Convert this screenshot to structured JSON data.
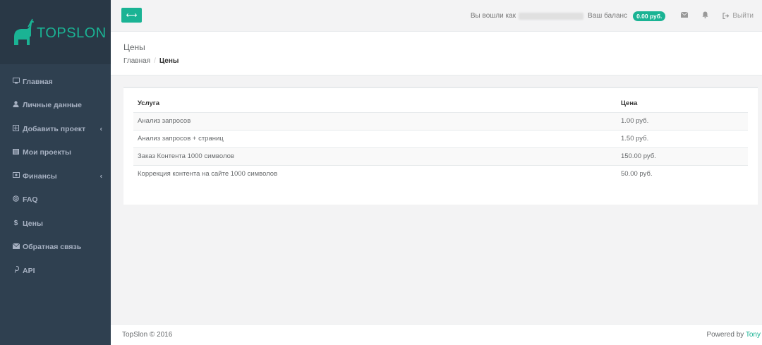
{
  "brand": {
    "name": "TOPSLON",
    "accent_color": "#1ab394"
  },
  "sidebar": {
    "items": [
      {
        "label": "Главная",
        "icon": "desktop-icon"
      },
      {
        "label": "Личные данные",
        "icon": "user-icon"
      },
      {
        "label": "Добавить проект",
        "icon": "plus-square-icon",
        "has_arrow": true
      },
      {
        "label": "Мои проекты",
        "icon": "list-icon"
      },
      {
        "label": "Финансы",
        "icon": "money-icon",
        "has_arrow": true
      },
      {
        "label": "FAQ",
        "icon": "lifebuoy-icon"
      },
      {
        "label": "Цены",
        "icon": "dollar-icon"
      },
      {
        "label": "Обратная связь",
        "icon": "envelope-icon"
      },
      {
        "label": "API",
        "icon": "pinterest-icon"
      }
    ]
  },
  "topbar": {
    "toggle_icon": "arrows-h-icon",
    "login_label": "Вы вошли как",
    "balance_label": "Ваш баланс",
    "balance_value": "0.00 руб.",
    "logout_label": "Выйти"
  },
  "page": {
    "title": "Цены",
    "breadcrumb_home": "Главная",
    "breadcrumb_sep": "/",
    "breadcrumb_current": "Цены"
  },
  "table": {
    "headers": {
      "service": "Услуга",
      "price": "Цена"
    },
    "rows": [
      {
        "service": "Анализ запросов",
        "price": "1.00 руб."
      },
      {
        "service": "Анализ запросов + страниц",
        "price": "1.50 руб."
      },
      {
        "service": "Заказ Контента 1000 символов",
        "price": "150.00 руб."
      },
      {
        "service": "Коррекция контента на сайте 1000 символов",
        "price": "50.00 руб."
      }
    ]
  },
  "footer": {
    "copyright": "TopSlon © 2016",
    "powered_by": "Powered by",
    "author": "Tony"
  }
}
